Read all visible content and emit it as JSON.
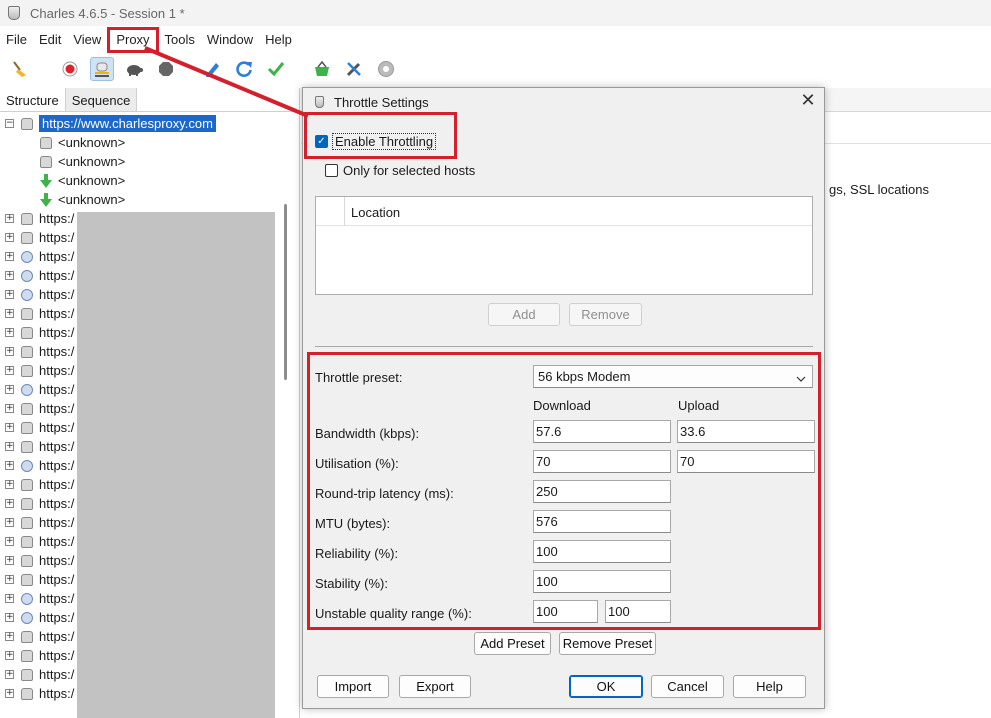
{
  "window": {
    "title": "Charles 4.6.5 - Session 1 *"
  },
  "menu": {
    "items": [
      "File",
      "Edit",
      "View",
      "Proxy",
      "Tools",
      "Window",
      "Help"
    ]
  },
  "left": {
    "tabs": [
      "Structure",
      "Sequence"
    ],
    "tree": {
      "selected_host": "https://www.charlesproxy.com",
      "children": [
        "<unknown>",
        "<unknown>",
        "<unknown>",
        "<unknown>"
      ],
      "other_hosts_prefix": "https:/"
    }
  },
  "right": {
    "partial_text": "gs, SSL locations"
  },
  "dialog": {
    "title": "Throttle Settings",
    "close": "✕",
    "enable_throttling": "Enable Throttling",
    "only_selected_hosts": "Only for selected hosts",
    "location_header": "Location",
    "add": "Add",
    "remove": "Remove",
    "preset_label": "Throttle preset:",
    "preset_value": "56 kbps Modem",
    "col_download": "Download",
    "col_upload": "Upload",
    "bandwidth_label": "Bandwidth (kbps):",
    "bandwidth_down": "57.6",
    "bandwidth_up": "33.6",
    "utilisation_label": "Utilisation (%):",
    "utilisation_down": "70",
    "utilisation_up": "70",
    "latency_label": "Round-trip latency (ms):",
    "latency": "250",
    "mtu_label": "MTU (bytes):",
    "mtu": "576",
    "reliability_label": "Reliability (%):",
    "reliability": "100",
    "stability_label": "Stability (%):",
    "stability": "100",
    "unstable_label": "Unstable quality range (%):",
    "unstable_min": "100",
    "unstable_max": "100",
    "add_preset": "Add Preset",
    "remove_preset": "Remove Preset",
    "import": "Import",
    "export": "Export",
    "ok": "OK",
    "cancel": "Cancel",
    "help": "Help"
  },
  "colors": {
    "annotation_red": "#d4202c",
    "selection_blue": "#1b68c9",
    "checkbox_blue": "#0067c0"
  }
}
